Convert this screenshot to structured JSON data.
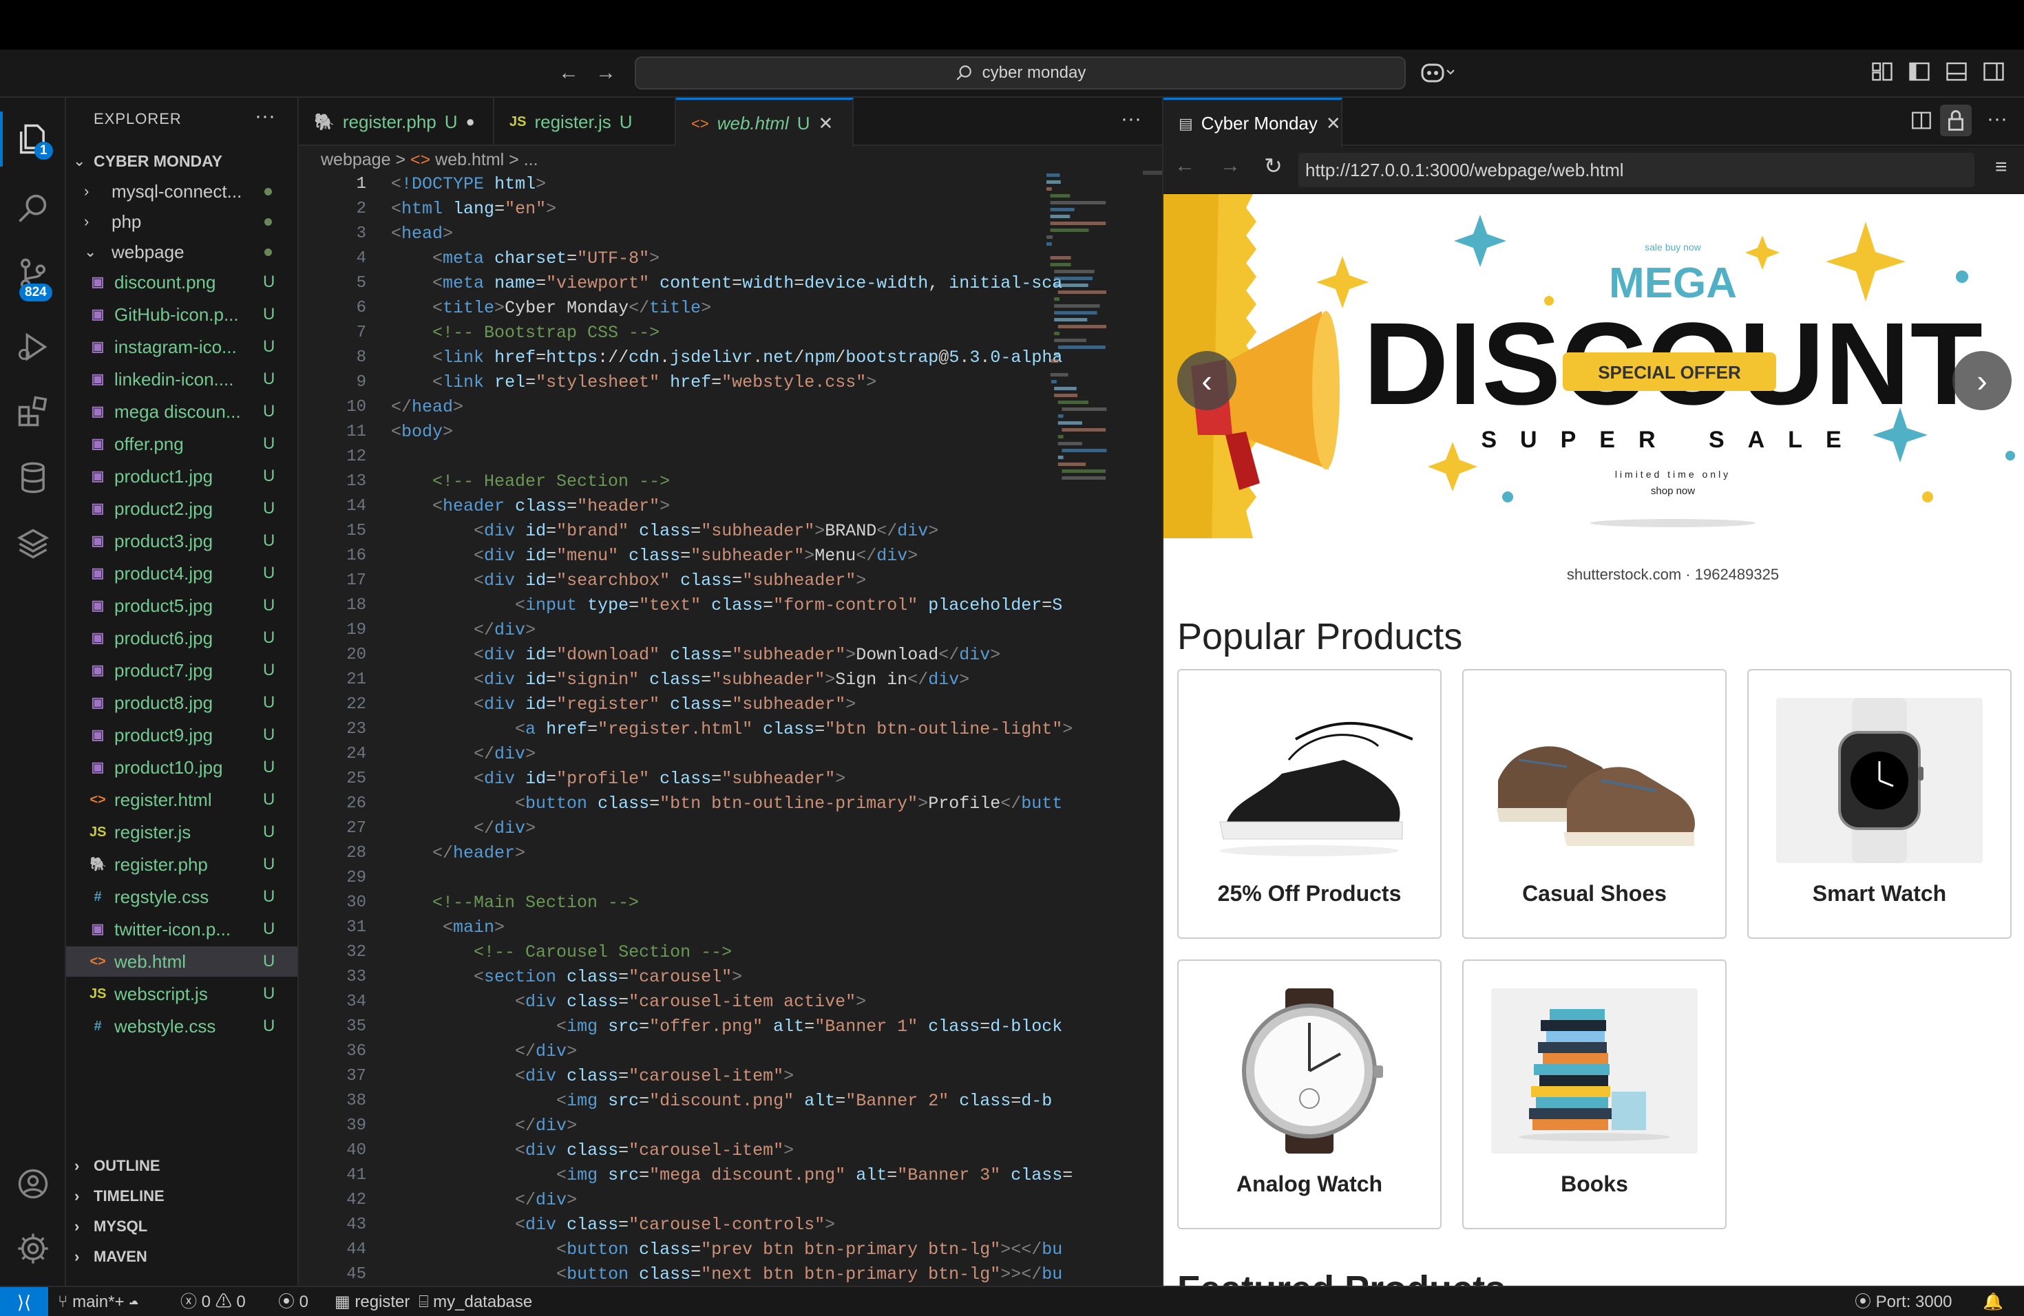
{
  "titlebar": {
    "search_text": "cyber monday"
  },
  "activity": {
    "explorer_badge": "1",
    "scm_badge": "824"
  },
  "explorer": {
    "header": "EXPLORER",
    "more": "···",
    "workspace": "CYBER MONDAY",
    "folders": [
      {
        "name": "mysql-connect..."
      },
      {
        "name": "php"
      },
      {
        "name": "webpage"
      }
    ],
    "files": [
      {
        "name": "discount.png",
        "status": "U",
        "icon": "image"
      },
      {
        "name": "GitHub-icon.p...",
        "status": "U",
        "icon": "image"
      },
      {
        "name": "instagram-ico...",
        "status": "U",
        "icon": "image"
      },
      {
        "name": "linkedin-icon....",
        "status": "U",
        "icon": "image"
      },
      {
        "name": "mega discoun...",
        "status": "U",
        "icon": "image"
      },
      {
        "name": "offer.png",
        "status": "U",
        "icon": "image"
      },
      {
        "name": "product1.jpg",
        "status": "U",
        "icon": "image"
      },
      {
        "name": "product2.jpg",
        "status": "U",
        "icon": "image"
      },
      {
        "name": "product3.jpg",
        "status": "U",
        "icon": "image"
      },
      {
        "name": "product4.jpg",
        "status": "U",
        "icon": "image"
      },
      {
        "name": "product5.jpg",
        "status": "U",
        "icon": "image"
      },
      {
        "name": "product6.jpg",
        "status": "U",
        "icon": "image"
      },
      {
        "name": "product7.jpg",
        "status": "U",
        "icon": "image"
      },
      {
        "name": "product8.jpg",
        "status": "U",
        "icon": "image"
      },
      {
        "name": "product9.jpg",
        "status": "U",
        "icon": "image"
      },
      {
        "name": "product10.jpg",
        "status": "U",
        "icon": "image"
      },
      {
        "name": "register.html",
        "status": "U",
        "icon": "html"
      },
      {
        "name": "register.js",
        "status": "U",
        "icon": "js"
      },
      {
        "name": "register.php",
        "status": "U",
        "icon": "php"
      },
      {
        "name": "regstyle.css",
        "status": "U",
        "icon": "css"
      },
      {
        "name": "twitter-icon.p...",
        "status": "U",
        "icon": "image"
      },
      {
        "name": "web.html",
        "status": "U",
        "icon": "html"
      },
      {
        "name": "webscript.js",
        "status": "U",
        "icon": "js"
      },
      {
        "name": "webstyle.css",
        "status": "U",
        "icon": "css"
      }
    ],
    "sections": [
      "OUTLINE",
      "TIMELINE",
      "MYSQL",
      "MAVEN"
    ]
  },
  "tabs": [
    {
      "name": "register.php",
      "status": "U",
      "icon": "php"
    },
    {
      "name": "register.js",
      "status": "U",
      "icon": "js"
    },
    {
      "name": "web.html",
      "status": "U",
      "icon": "html"
    }
  ],
  "breadcrumb": {
    "folder": "webpage",
    "sep": ">",
    "file": "web.html",
    "rest": "> ..."
  },
  "code": {
    "line_numbers": [
      "1",
      "2",
      "3",
      "4",
      "5",
      "6",
      "7",
      "8",
      "9",
      "10",
      "11",
      "12",
      "13",
      "14",
      "15",
      "16",
      "17",
      "18",
      "19",
      "20",
      "21",
      "22",
      "23",
      "24",
      "25",
      "26",
      "27",
      "28",
      "29",
      "30",
      "31",
      "32",
      "33",
      "34",
      "35",
      "36",
      "37",
      "38",
      "39",
      "40",
      "41",
      "42",
      "43",
      "44",
      "45"
    ],
    "lines": [
      "<!DOCTYPE html>",
      "<html lang=\"en\">",
      "<head>",
      "    <meta charset=\"UTF-8\">",
      "    <meta name=\"viewport\" content=\"width=device-width, initial-sca",
      "    <title>Cyber Monday</title>",
      "    <!-- Bootstrap CSS -->",
      "    <link href=\"https://cdn.jsdelivr.net/npm/bootstrap@5.3.0-alpha",
      "    <link rel=\"stylesheet\" href=\"webstyle.css\">",
      "</head>",
      "<body>",
      "",
      "    <!-- Header Section -->",
      "    <header class=\"header\">",
      "        <div id=\"brand\" class=\"subheader\">BRAND</div>",
      "        <div id=\"menu\" class=\"subheader\">Menu</div>",
      "        <div id=\"searchbox\" class=\"subheader\">",
      "            <input type=\"text\" class=\"form-control\" placeholder=\"S",
      "        </div>",
      "        <div id=\"download\" class=\"subheader\">Download</div>",
      "        <div id=\"signin\" class=\"subheader\">Sign in</div>",
      "        <div id=\"register\" class=\"subheader\">",
      "            <a href=\"register.html\" class=\"btn btn-outline-light\">",
      "        </div>",
      "        <div id=\"profile\" class=\"subheader\">",
      "            <button class=\"btn btn-outline-primary\">Profile</butt",
      "        </div>",
      "    </header>",
      "",
      "    <!--Main Section -->",
      "     <main>",
      "        <!-- Carousel Section -->",
      "        <section class=\"carousel\">",
      "            <div class=\"carousel-item active\">",
      "                <img src=\"offer.png\" alt=\"Banner 1\" class=\"d-block",
      "            </div>",
      "            <div class=\"carousel-item\">",
      "                <img src=\"discount.png\" alt=\"Banner 2\" class=\"d-b",
      "            </div>",
      "            <div class=\"carousel-item\">",
      "                <img src=\"mega discount.png\" alt=\"Banner 3\" class=",
      "            </div>",
      "            <div class=\"carousel-controls\">",
      "                <button class=\"prev btn btn-primary btn-lg\"><</bu",
      "                <button class=\"next btn btn-primary btn-lg\">></bu"
    ]
  },
  "preview": {
    "tab_title": "Cyber Monday",
    "url": "http://127.0.0.1:3000/webpage/web.html",
    "banner": {
      "top_small": "sale buy now",
      "mega": "MEGA",
      "discount": "DISCOUNT",
      "ribbon": "SPECIAL OFFER",
      "super_sale": "SUPER SALE",
      "limited": "limited time only",
      "shop_now": "shop now",
      "watermark": "shutterstock.com · 1962489325",
      "prev": "‹",
      "next": "›"
    },
    "section_title": "Popular Products",
    "products": [
      {
        "title": "25% Off Products"
      },
      {
        "title": "Casual Shoes"
      },
      {
        "title": "Smart Watch"
      },
      {
        "title": "Analog Watch"
      },
      {
        "title": "Books"
      }
    ],
    "next_section_partial": "Featured Products"
  },
  "statusbar": {
    "branch": "main*+",
    "errors": "0",
    "warnings": "0",
    "ports": "0",
    "db_connection": "register",
    "database": "my_database",
    "port": "Port: 3000"
  },
  "colors": {
    "accent": "#0078d4",
    "untracked": "#73c991",
    "sidebar": "#181818",
    "editor": "#1f1f1f"
  }
}
